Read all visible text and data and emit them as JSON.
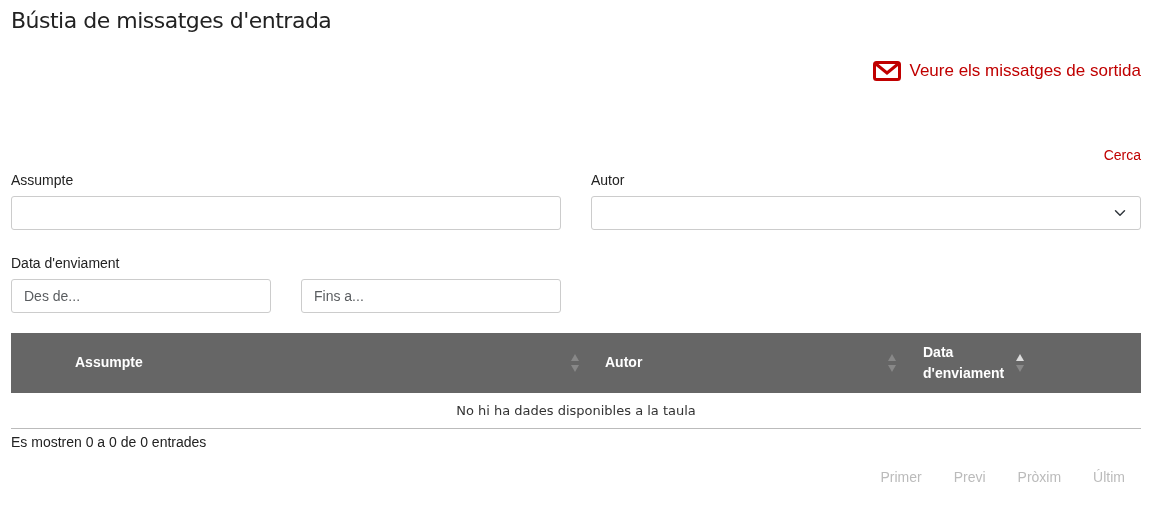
{
  "page_title": "Bústia de missatges d'entrada",
  "outbox_link": "Veure els missatges de sortida",
  "search_link": "Cerca",
  "filters": {
    "subject": {
      "label": "Assumpte"
    },
    "author": {
      "label": "Autor"
    },
    "date": {
      "label": "Data d'enviament",
      "from_placeholder": "Des de...",
      "to_placeholder": "Fins a..."
    }
  },
  "table": {
    "columns": [
      {
        "label": "Assumpte",
        "sorted": false
      },
      {
        "label": "Autor",
        "sorted": false
      },
      {
        "label": "Data d'enviament",
        "sorted": true
      }
    ],
    "empty_message": "No hi ha dades disponibles a la taula"
  },
  "info": "Es mostren 0 a 0 de 0 entrades",
  "pager": [
    {
      "label": "Primer",
      "disabled": true
    },
    {
      "label": "Previ",
      "disabled": true
    },
    {
      "label": "Pròxim",
      "disabled": true
    },
    {
      "label": "Últim",
      "disabled": true
    }
  ]
}
